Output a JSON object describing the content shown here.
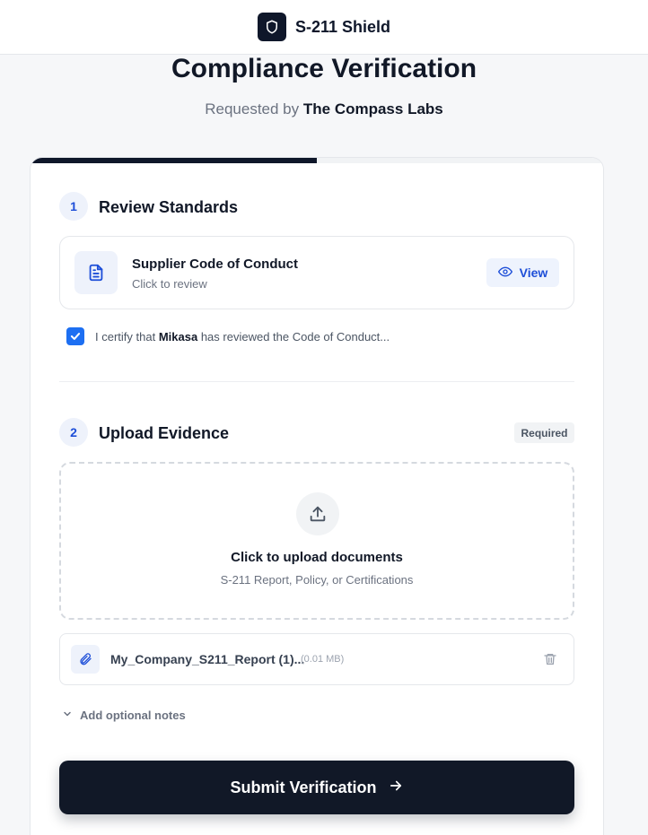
{
  "header": {
    "brand": "S-211 Shield",
    "logo_icon": "shield-icon"
  },
  "page": {
    "title": "Compliance Verification",
    "requested_prefix": "Requested by",
    "requester": "The Compass Labs"
  },
  "progress": {
    "fraction": 0.5
  },
  "step1": {
    "number": "1",
    "title": "Review Standards",
    "document": {
      "name": "Supplier Code of Conduct",
      "hint": "Click to review",
      "icon": "document-icon"
    },
    "view_button": {
      "label": "View",
      "icon": "eye-icon"
    },
    "certify": {
      "checked": true,
      "prefix": "I certify that",
      "name": "Mikasa",
      "suffix": "has reviewed the Code of Conduct..."
    }
  },
  "step2": {
    "number": "2",
    "title": "Upload Evidence",
    "badge": "Required",
    "dropzone": {
      "title": "Click to upload documents",
      "subtitle": "S-211 Report, Policy, or Certifications",
      "icon": "upload-icon"
    },
    "file": {
      "name": "My_Company_S211_Report (1)...",
      "size": "(0.01 MB)",
      "icon": "paperclip-icon",
      "delete_icon": "trash-icon"
    },
    "notes_toggle": "Add optional notes"
  },
  "submit": {
    "label": "Submit Verification",
    "icon": "arrow-right-icon"
  },
  "colors": {
    "primary_dark": "#111827",
    "accent_blue": "#1d4ed8",
    "checkbox_blue": "#1d6ff2",
    "background": "#f6f7f9"
  }
}
